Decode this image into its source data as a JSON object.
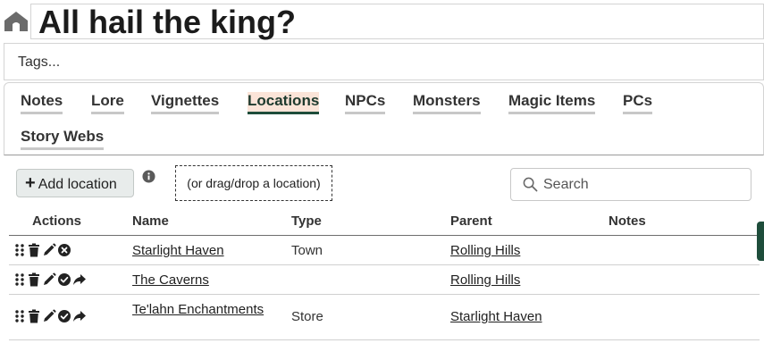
{
  "header": {
    "title": "All hail the king?"
  },
  "tags": {
    "placeholder": "Tags..."
  },
  "tabs": [
    {
      "label": "Notes",
      "active": false
    },
    {
      "label": "Lore",
      "active": false
    },
    {
      "label": "Vignettes",
      "active": false
    },
    {
      "label": "Locations",
      "active": true
    },
    {
      "label": "NPCs",
      "active": false
    },
    {
      "label": "Monsters",
      "active": false
    },
    {
      "label": "Magic Items",
      "active": false
    },
    {
      "label": "PCs",
      "active": false
    },
    {
      "label": "Story Webs",
      "active": false
    }
  ],
  "toolbar": {
    "add_label": "Add location",
    "drop_hint": "(or drag/drop a location)",
    "search_placeholder": "Search"
  },
  "table": {
    "columns": [
      "Actions",
      "Name",
      "Type",
      "Parent",
      "Notes"
    ],
    "rows": [
      {
        "name": "Starlight Haven",
        "type": "Town",
        "parent": "Rolling Hills",
        "notes": "",
        "icons": [
          "drag-handle-icon",
          "trash-icon",
          "pencil-icon",
          "remove-circle-icon"
        ]
      },
      {
        "name": "The Caverns",
        "type": "",
        "parent": "Rolling Hills",
        "notes": "",
        "icons": [
          "drag-handle-icon",
          "trash-icon",
          "pencil-icon",
          "check-circle-icon",
          "share-arrow-icon"
        ]
      },
      {
        "name": "Te'lahn Enchantments",
        "type": "Store",
        "parent": "Starlight Haven",
        "notes": "",
        "icons": [
          "drag-handle-icon",
          "trash-icon",
          "pencil-icon",
          "check-circle-icon",
          "share-arrow-icon"
        ]
      }
    ]
  },
  "colors": {
    "accent": "#1e4d3b",
    "active_tab_bg": "#fbe4d8"
  }
}
